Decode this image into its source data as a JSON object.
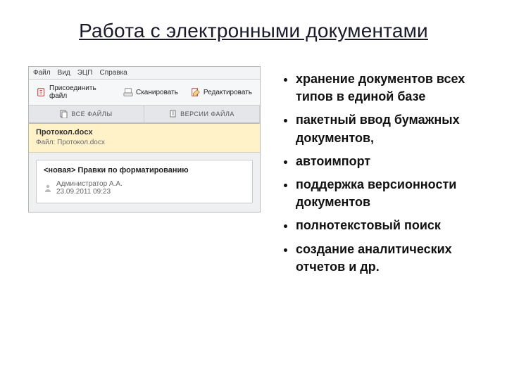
{
  "title": "Работа с электронными документами",
  "bullets": [
    "хранение документов всех типов в единой базе",
    "пакетный ввод бумажных документов,",
    "автоимпорт",
    "поддержка версионности документов",
    "полнотекстовый поиск",
    "создание аналитических отчетов и др."
  ],
  "app": {
    "menu": {
      "file": "Файл",
      "view": "Вид",
      "ecp": "ЭЦП",
      "help": "Справка"
    },
    "toolbar": {
      "attach": "Присоединить файл",
      "scan": "Сканировать",
      "edit": "Редактировать"
    },
    "tabs": {
      "all_files": "ВСЕ ФАЙЛЫ",
      "versions": "ВЕРСИИ ФАЙЛА"
    },
    "file_header": {
      "name": "Протокол.docx",
      "label": "Файл:",
      "value": "Протокол.docx"
    },
    "card": {
      "title": "<новая> Правки по форматированию",
      "author": "Администратор А.А.",
      "date": "23.09.2011 09:23"
    }
  }
}
